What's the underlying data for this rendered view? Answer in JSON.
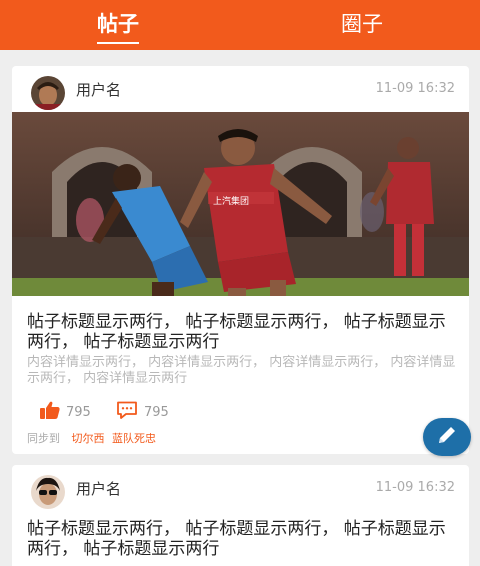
{
  "tabs": [
    {
      "label": "帖子",
      "active": true
    },
    {
      "label": "圈子",
      "active": false
    }
  ],
  "posts": [
    {
      "username": "用户名",
      "time": "11-09 16:32",
      "title": "帖子标题显示两行， 帖子标题显示两行， 帖子标题显示两行， 帖子标题显示两行",
      "description": "内容详情显示两行， 内容详情显示两行， 内容详情显示两行， 内容详情显示两行， 内容详情显示两行",
      "likes": "795",
      "comments": "795",
      "sync_label": "同步到",
      "channels": [
        "切尔西",
        "蓝队死忠"
      ],
      "jersey_text": "上汽集团"
    },
    {
      "username": "用户名",
      "time": "11-09 16:32",
      "title": "帖子标题显示两行， 帖子标题显示两行， 帖子标题显示两行， 帖子标题显示两行"
    }
  ],
  "icons": {
    "like": "thumbs-up-icon",
    "comment": "comment-bubble-icon",
    "compose": "pencil-icon"
  },
  "colors": {
    "brand": "#f25a1c",
    "fab": "#1e6fa8"
  }
}
